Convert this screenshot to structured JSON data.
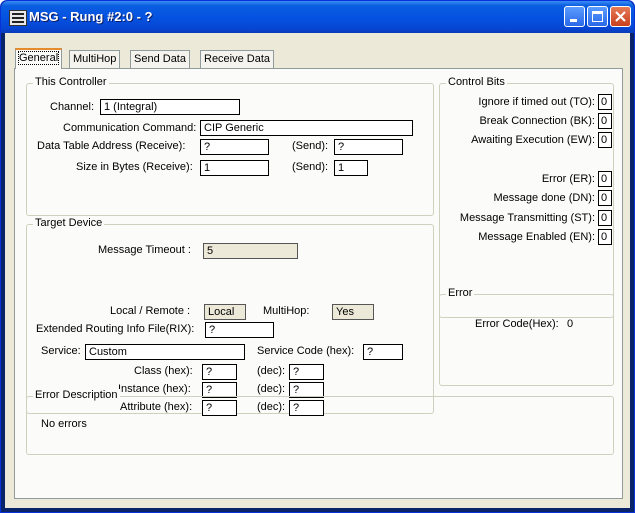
{
  "window": {
    "title": "MSG - Rung #2:0 - ?"
  },
  "tabs": [
    {
      "label": "General"
    },
    {
      "label": "MultiHop"
    },
    {
      "label": "Send Data"
    },
    {
      "label": "Receive Data"
    }
  ],
  "this_controller": {
    "legend": "This Controller",
    "channel_label": "Channel:",
    "channel_value": "1 (Integral)",
    "comm_label": "Communication Command:",
    "comm_value": "CIP Generic",
    "dta_label": "Data Table Address (Receive):",
    "dta_receive": "?",
    "send_label": "(Send):",
    "dta_send": "?",
    "size_label": "Size in Bytes (Receive):",
    "size_receive": "1",
    "size_send_label": "(Send):",
    "size_send": "1"
  },
  "target_device": {
    "legend": "Target Device",
    "timeout_label": "Message Timeout :",
    "timeout_value": "5",
    "local_remote_label": "Local / Remote :",
    "local_remote_value": "Local",
    "multihop_label": "MultiHop:",
    "multihop_value": "Yes",
    "rix_label": "Extended Routing Info File(RIX):",
    "rix_value": "?",
    "service_label": "Service:",
    "service_value": "Custom",
    "service_code_label": "Service Code (hex):",
    "service_code_value": "?",
    "class_label": "Class (hex):",
    "class_hex": "?",
    "class_dec_label": "(dec):",
    "class_dec": "?",
    "instance_label": "Instance (hex):",
    "instance_hex": "?",
    "instance_dec_label": "(dec):",
    "instance_dec": "?",
    "attribute_label": "Attribute (hex):",
    "attribute_hex": "?",
    "attribute_dec_label": "(dec):",
    "attribute_dec": "?"
  },
  "control_bits": {
    "legend": "Control Bits",
    "items": [
      {
        "label": "Ignore if timed out (TO):",
        "value": "0"
      },
      {
        "label": "Break Connection (BK):",
        "value": "0"
      },
      {
        "label": "Awaiting Execution (EW):",
        "value": "0"
      },
      {
        "label": "Error (ER):",
        "value": "0"
      },
      {
        "label": "Message done (DN):",
        "value": "0"
      },
      {
        "label": "Message Transmitting (ST):",
        "value": "0"
      },
      {
        "label": "Message Enabled (EN):",
        "value": "0"
      }
    ]
  },
  "error": {
    "legend": "Error",
    "code_label": "Error Code(Hex):",
    "code_value": "0"
  },
  "error_description": {
    "legend": "Error Description",
    "text": "No errors"
  }
}
